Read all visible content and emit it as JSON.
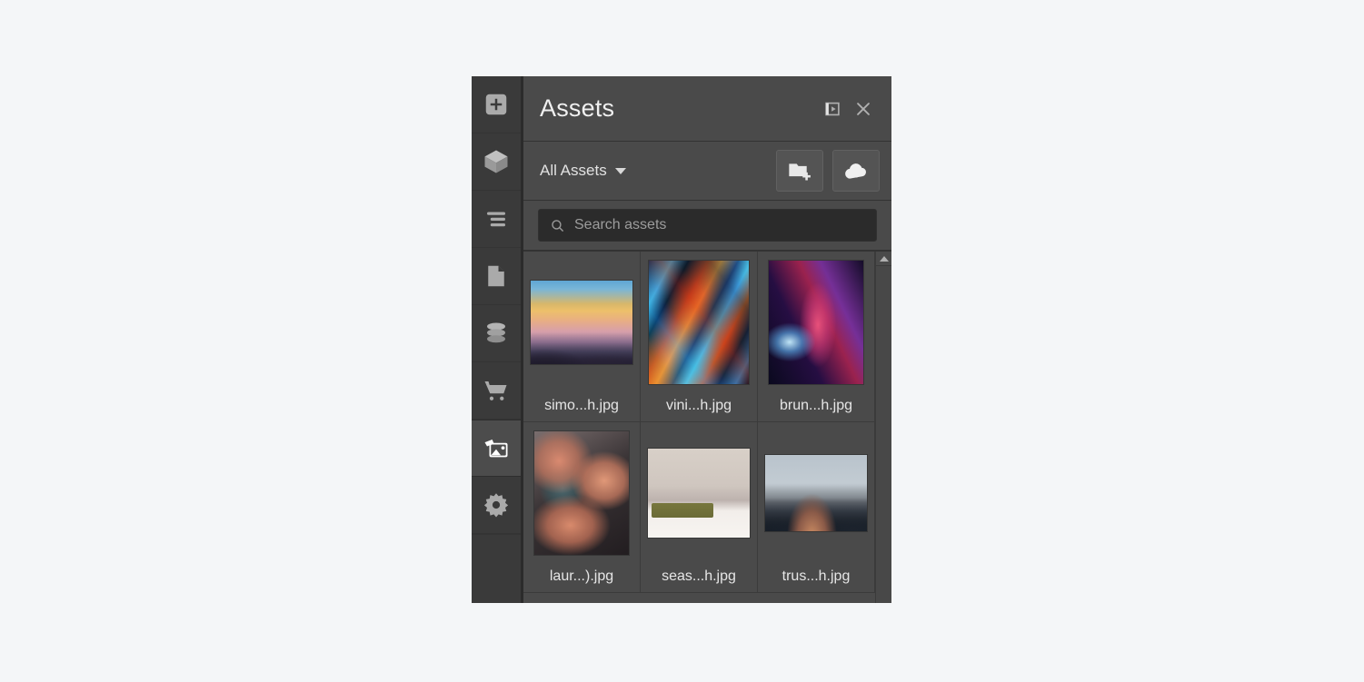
{
  "panel": {
    "title": "Assets",
    "header_actions": [
      {
        "name": "dock-panel-icon",
        "label": "Dock panel"
      },
      {
        "name": "close-icon",
        "label": "Close"
      }
    ]
  },
  "toolbar": {
    "filter_label": "All Assets",
    "new_folder_label": "New folder",
    "upload_label": "Upload"
  },
  "search": {
    "placeholder": "Search assets",
    "value": ""
  },
  "sidebar": {
    "items": [
      {
        "name": "add-button",
        "icon": "plus-square-icon",
        "label": "Add",
        "selected": false
      },
      {
        "name": "components-item",
        "icon": "cube-icon",
        "label": "Components",
        "selected": false
      },
      {
        "name": "layers-item",
        "icon": "layers-list-icon",
        "label": "Layers",
        "selected": false
      },
      {
        "name": "pages-item",
        "icon": "page-icon",
        "label": "Pages",
        "selected": false
      },
      {
        "name": "data-item",
        "icon": "database-icon",
        "label": "Data",
        "selected": false
      },
      {
        "name": "ecommerce-item",
        "icon": "cart-icon",
        "label": "Ecommerce",
        "selected": false
      },
      {
        "name": "assets-item",
        "icon": "images-icon",
        "label": "Assets",
        "selected": true
      },
      {
        "name": "settings-item",
        "icon": "gear-icon",
        "label": "Settings",
        "selected": false
      }
    ]
  },
  "assets": {
    "items": [
      {
        "name": "simo...h.jpg",
        "thumb": "th-sunset",
        "shape": "t-landscape"
      },
      {
        "name": "vini...h.jpg",
        "thumb": "th-foil",
        "shape": "t-portrait"
      },
      {
        "name": "brun...h.jpg",
        "thumb": "th-neon",
        "shape": "t-portrait-n"
      },
      {
        "name": "laur...).jpg",
        "thumb": "th-clouds",
        "shape": "t-portrait-n"
      },
      {
        "name": "seas...h.jpg",
        "thumb": "th-bedroom",
        "shape": "t-sq"
      },
      {
        "name": "trus...h.jpg",
        "thumb": "th-peak",
        "shape": "t-wide"
      }
    ]
  },
  "scrollbar": {
    "up_label": "Scroll up"
  },
  "colors": {
    "panel_bg": "#4a4a4a",
    "rail_bg": "#3a3a3a",
    "selected_bg": "#4c4c4c",
    "text": "#e6e6e6",
    "search_bg": "#2b2b2b",
    "page_bg": "#f4f6f8"
  }
}
